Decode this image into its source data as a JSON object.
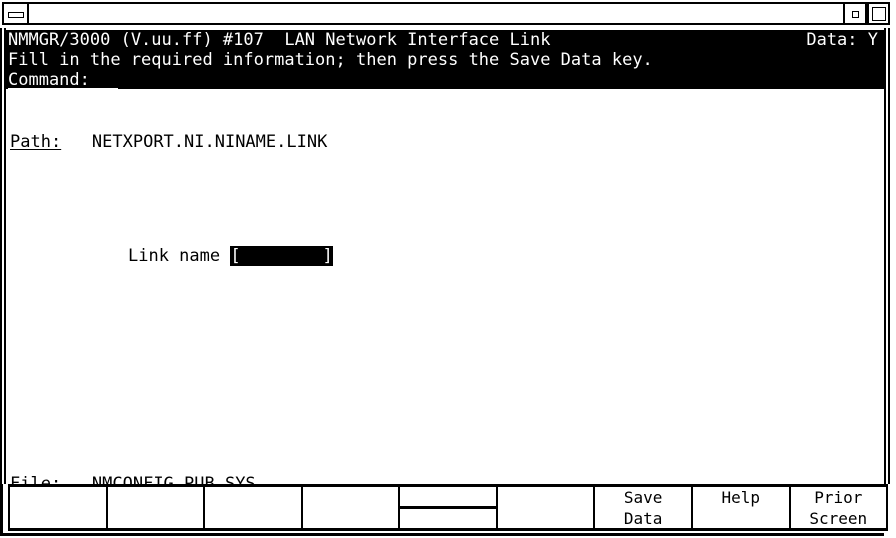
{
  "titlebar": {
    "minimize_icon": "minimize-icon",
    "restore_icon": "restore-icon",
    "maximize_icon": "maximize-icon",
    "title": ""
  },
  "header": {
    "line1": "NMMGR/3000 (V.uu.ff) #107  LAN Network Interface Link",
    "data_indicator": "Data: Y",
    "line2": "Fill in the required information; then press the Save Data key.",
    "command_label": "Command:",
    "command_value": ""
  },
  "form": {
    "path_label": "Path:",
    "path_value": "NETXPORT.NI.NINAME.LINK",
    "link_name_label": "Link name",
    "link_name_open_bracket": "[",
    "link_name_value": "        ",
    "link_name_close_bracket": "]",
    "file_label": "File:",
    "file_value": "NMCONFIG.PUB.SYS"
  },
  "function_keys": [
    {
      "line1": "",
      "line2": "",
      "divided": false
    },
    {
      "line1": "",
      "line2": "",
      "divided": false
    },
    {
      "line1": "",
      "line2": "",
      "divided": false
    },
    {
      "line1": "",
      "line2": "",
      "divided": false
    },
    {
      "line1": "",
      "line2": "",
      "divided": true
    },
    {
      "line1": "",
      "line2": "",
      "divided": false
    },
    {
      "line1": "Save",
      "line2": "Data",
      "divided": false
    },
    {
      "line1": "Help",
      "line2": "",
      "divided": false
    },
    {
      "line1": "Prior",
      "line2": "Screen",
      "divided": false
    }
  ],
  "colors": {
    "foreground": "#000000",
    "background": "#ffffff",
    "inverse_fg": "#ffffff",
    "inverse_bg": "#000000"
  }
}
